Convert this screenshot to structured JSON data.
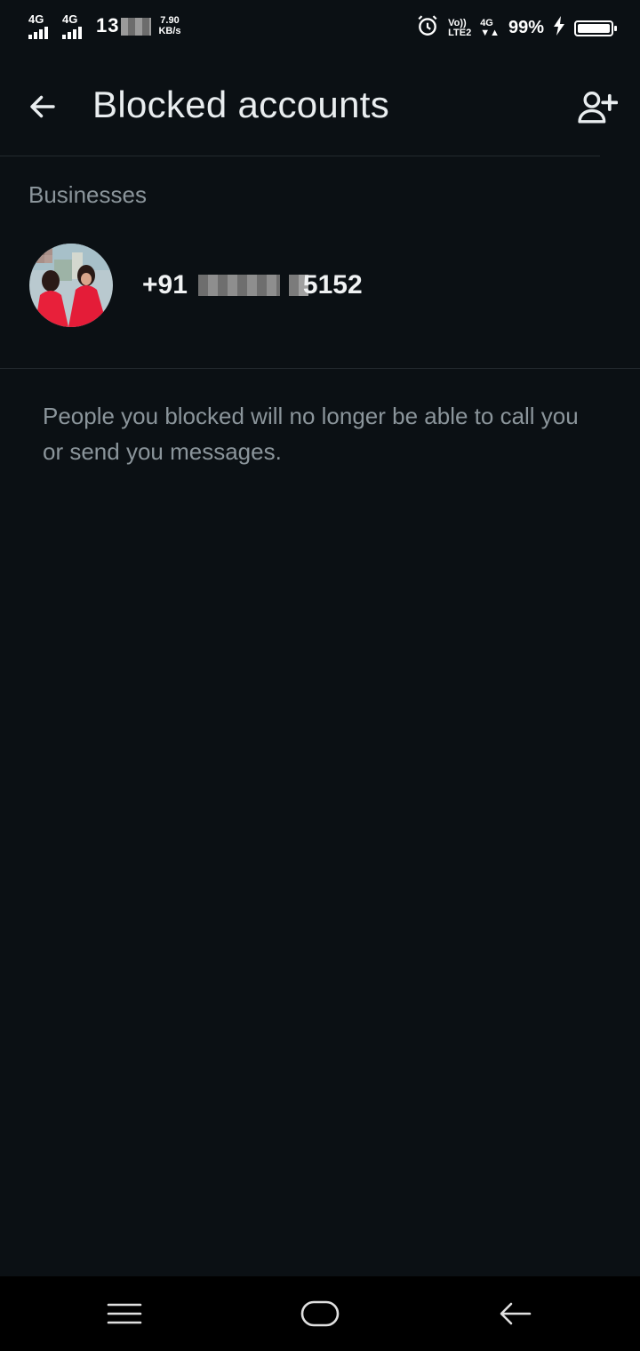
{
  "status_bar": {
    "network_1": "4G",
    "network_2": "4G",
    "time": "13",
    "speed_value": "7.90",
    "speed_unit": "KB/s",
    "volte": "Vo))",
    "lte": "LTE2",
    "network_3": "4G",
    "battery_percent": "99%",
    "battery_level": 0.99,
    "icons": [
      "signal-icon",
      "alarm-icon",
      "charging-icon",
      "battery-icon"
    ]
  },
  "app_bar": {
    "title": "Blocked accounts",
    "back_icon": "arrow-left-icon",
    "add_icon": "add-person-icon"
  },
  "section": {
    "title": "Businesses"
  },
  "blocked_accounts": [
    {
      "country_code": "+91",
      "number_suffix": "5152",
      "avatar": "avatar"
    }
  ],
  "info": {
    "text": "People you blocked will no longer be able to call you or send you messages."
  },
  "system_nav": {
    "icons": [
      "menu-icon",
      "home-icon",
      "back-icon"
    ]
  },
  "colors": {
    "background": "#0b1014",
    "title_text": "#e9edef",
    "secondary_text": "#8b959b",
    "divider": "#232a2f",
    "nav_background": "#000000"
  }
}
